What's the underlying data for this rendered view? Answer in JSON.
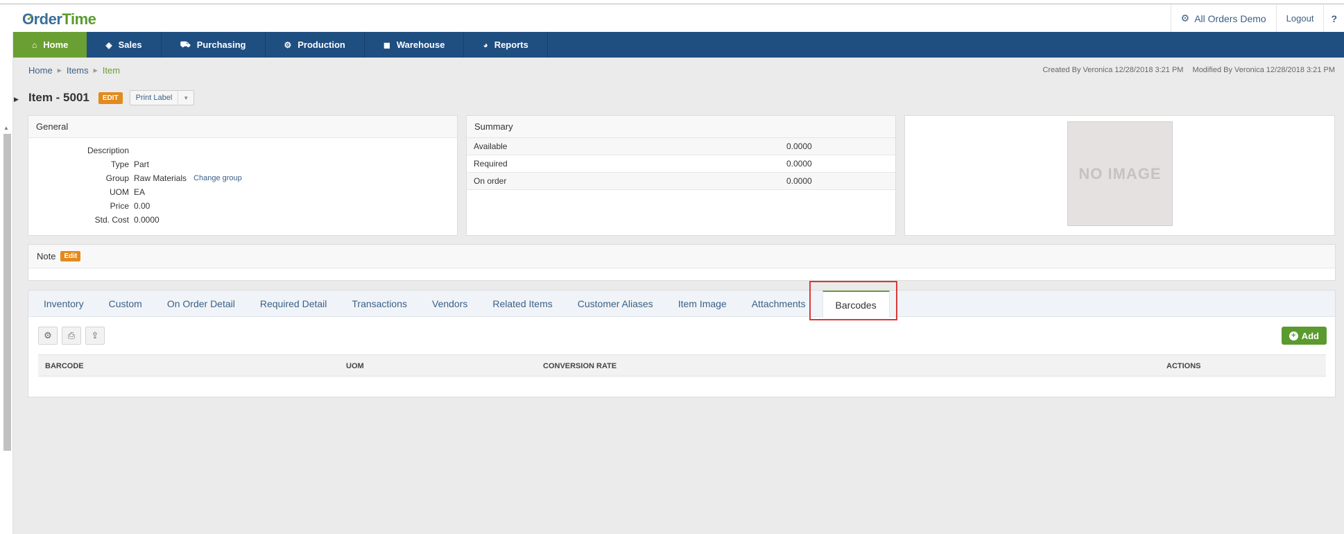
{
  "app": {
    "logo_first": "Order",
    "logo_second": "Time",
    "company_label": "All Orders Demo",
    "logout_label": "Logout",
    "help_label": "?"
  },
  "nav": {
    "items": [
      {
        "label": "Home",
        "icon": "home-icon"
      },
      {
        "label": "Sales",
        "icon": "tag-icon"
      },
      {
        "label": "Purchasing",
        "icon": "cart-icon"
      },
      {
        "label": "Production",
        "icon": "gears-icon"
      },
      {
        "label": "Warehouse",
        "icon": "cube-icon"
      },
      {
        "label": "Reports",
        "icon": "pie-chart-icon"
      }
    ],
    "active": "Home",
    "active_color": "#6aa033",
    "bar_color": "#1f4e80"
  },
  "breadcrumb": {
    "home": "Home",
    "items": "Items",
    "current": "Item"
  },
  "audit": {
    "created": "Created By Veronica 12/28/2018 3:21 PM",
    "modified": "Modified By Veronica 12/28/2018 3:21 PM"
  },
  "title": {
    "text": "Item - 5001",
    "edit_label": "EDIT",
    "print_label": "Print Label"
  },
  "general": {
    "heading": "General",
    "rows": [
      {
        "key": "Description",
        "value": ""
      },
      {
        "key": "Type",
        "value": "Part"
      },
      {
        "key": "Group",
        "value": "Raw Materials"
      },
      {
        "key": "UOM",
        "value": "EA"
      },
      {
        "key": "Price",
        "value": "0.00"
      },
      {
        "key": "Std. Cost",
        "value": "0.0000"
      }
    ],
    "change_group_link": "Change group"
  },
  "summary": {
    "heading": "Summary",
    "rows": [
      {
        "label": "Available",
        "value": "0.0000"
      },
      {
        "label": "Required",
        "value": "0.0000"
      },
      {
        "label": "On order",
        "value": "0.0000"
      }
    ]
  },
  "image": {
    "placeholder": "NO IMAGE"
  },
  "note": {
    "heading": "Note",
    "edit_label": "Edit"
  },
  "tabs": {
    "items": [
      "Inventory",
      "Custom",
      "On Order Detail",
      "Required Detail",
      "Transactions",
      "Vendors",
      "Related Items",
      "Customer Aliases",
      "Item Image",
      "Attachments",
      "Barcodes"
    ],
    "active": "Barcodes"
  },
  "barcodes": {
    "add_label": "Add",
    "columns": [
      "BARCODE",
      "UOM",
      "CONVERSION RATE",
      "ACTIONS"
    ]
  }
}
